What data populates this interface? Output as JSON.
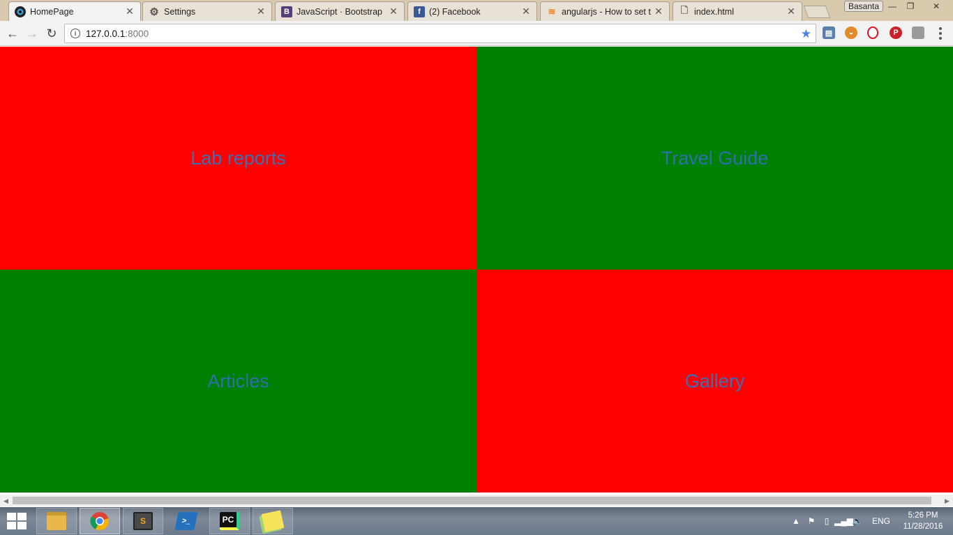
{
  "browser": {
    "tabs": [
      {
        "title": "HomePage",
        "icon": "homepage-favicon",
        "active": true
      },
      {
        "title": "Settings",
        "icon": "gear-icon",
        "active": false
      },
      {
        "title": "JavaScript · Bootstrap",
        "icon": "bootstrap-icon",
        "active": false
      },
      {
        "title": "(2) Facebook",
        "icon": "facebook-icon",
        "active": false
      },
      {
        "title": "angularjs - How to set th",
        "icon": "stackoverflow-icon",
        "active": false
      },
      {
        "title": "index.html",
        "icon": "document-icon",
        "active": false
      }
    ],
    "profile_name": "Basanta",
    "window_controls": {
      "minimize": "—",
      "restore": "❐",
      "close": "✕"
    },
    "nav": {
      "back": "←",
      "forward": "→",
      "reload": "↻"
    },
    "omnibox": {
      "host": "127.0.0.1",
      "port": ":8000",
      "info": "i",
      "star": "★"
    }
  },
  "page": {
    "tiles": [
      {
        "label": "Lab reports",
        "bg": "#ff0000",
        "color": "#3b6fb6"
      },
      {
        "label": "Travel Guide",
        "bg": "#008000",
        "color": "#2e6fb0"
      },
      {
        "label": "Articles",
        "bg": "#008000",
        "color": "#2e6fb0"
      },
      {
        "label": "Gallery",
        "bg": "#ff0000",
        "color": "#3b6fb6"
      }
    ]
  },
  "taskbar": {
    "apps": [
      {
        "name": "file-explorer",
        "glyph": "📁"
      },
      {
        "name": "chrome",
        "glyph": ""
      },
      {
        "name": "sublime-text",
        "glyph": "S"
      },
      {
        "name": "powershell",
        "glyph": ">_"
      },
      {
        "name": "pycharm",
        "glyph": "PC"
      },
      {
        "name": "sticky-notes",
        "glyph": ""
      }
    ],
    "tray": {
      "language": "ENG",
      "time": "5:26 PM",
      "date": "11/28/2016"
    }
  }
}
